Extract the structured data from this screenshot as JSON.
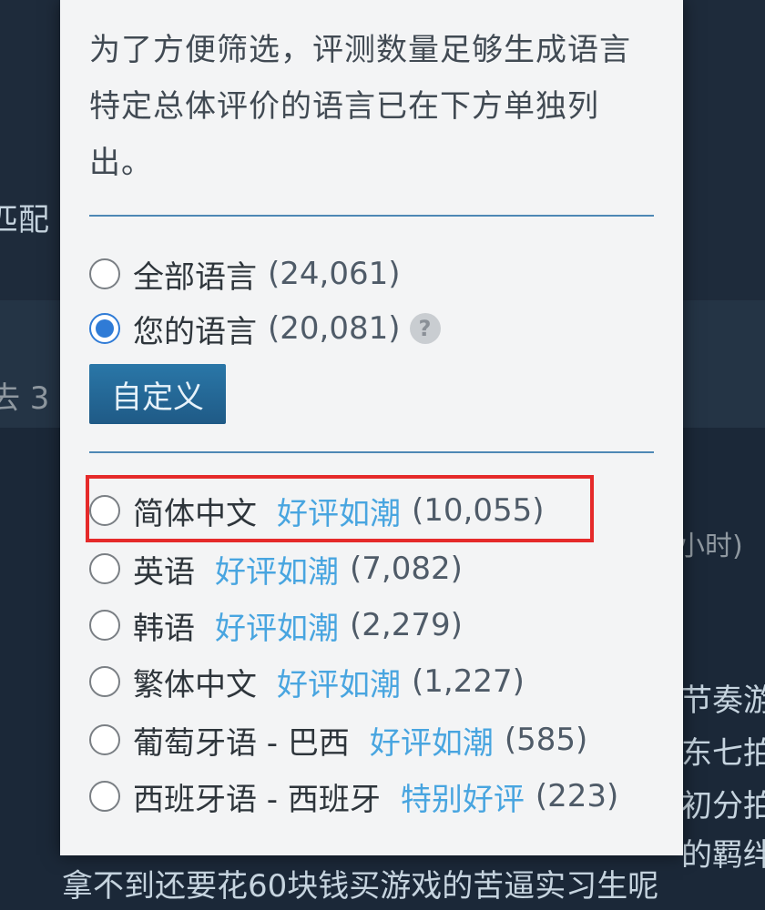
{
  "background": {
    "left_fragment": "匹配",
    "tab_fragment": "去 3",
    "hours_fragment": "小时)",
    "right_lines": [
      "节奏游",
      "东七拍",
      "初分拍",
      "的羁绊"
    ],
    "bottom_line": "拿不到还要花60块钱买游戏的苦逼实习生呢"
  },
  "popup": {
    "note": "为了方便筛选，评测数量足够生成语言特定总体评价的语言已在下方单独列出。",
    "scope_options": [
      {
        "label": "全部语言",
        "count": "(24,061)",
        "checked": false
      },
      {
        "label": "您的语言",
        "count": "(20,081)",
        "checked": true
      }
    ],
    "help_icon": "?",
    "custom_button": "自定义",
    "languages": [
      {
        "label": "简体中文",
        "rating": "好评如潮",
        "count": "(10,055)",
        "highlighted": true
      },
      {
        "label": "英语",
        "rating": "好评如潮",
        "count": "(7,082)"
      },
      {
        "label": "韩语",
        "rating": "好评如潮",
        "count": "(2,279)"
      },
      {
        "label": "繁体中文",
        "rating": "好评如潮",
        "count": "(1,227)"
      },
      {
        "label": "葡萄牙语 - 巴西",
        "rating": "好评如潮",
        "count": "(585)"
      },
      {
        "label": "西班牙语 - 西班牙",
        "rating": "特别好评",
        "count": "(223)"
      }
    ]
  },
  "colors": {
    "rating_blue": "#48a5e0",
    "highlight_red": "#e52a2a",
    "radio_checked": "#2f7bd6"
  }
}
